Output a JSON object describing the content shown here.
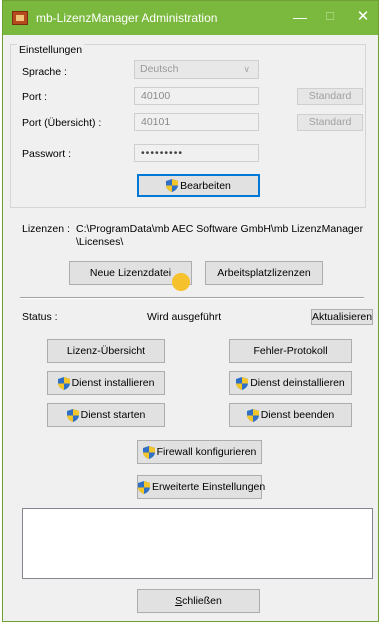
{
  "window": {
    "title": "mb-LizenzManager Administration",
    "controls": {
      "minimize": "—",
      "maximize": "☐",
      "close": "✕"
    },
    "accent_color": "#7ab93d"
  },
  "settings": {
    "group_label": "Einstellungen",
    "language": {
      "label": "Sprache :",
      "value": "Deutsch"
    },
    "port": {
      "label": "Port :",
      "value": "40100",
      "default_button": "Standard"
    },
    "port_overview": {
      "label": "Port (Übersicht) :",
      "value": "40101",
      "default_button": "Standard"
    },
    "password": {
      "label": "Passwort :",
      "value": "•••••••••"
    },
    "edit_button": "Bearbeiten"
  },
  "licenses": {
    "label": "Lizenzen :",
    "path_line1": "C:\\ProgramData\\mb AEC Software GmbH\\mb LizenzManager",
    "path_line2": "\\Licenses\\",
    "new_file_button": "Neue Lizenzdatei",
    "workstation_button": "Arbeitsplatzlizenzen"
  },
  "status": {
    "label": "Status :",
    "value": "Wird ausgeführt",
    "refresh_button": "Aktualisieren"
  },
  "actions": {
    "overview": "Lizenz-Übersicht",
    "error_log": "Fehler-Protokoll",
    "install_service": "Dienst installieren",
    "uninstall_service": "Dienst deinstallieren",
    "start_service": "Dienst starten",
    "stop_service": "Dienst beenden",
    "configure_firewall": "Firewall konfigurieren",
    "advanced_settings": "Erweiterte Einstellungen"
  },
  "footer": {
    "close_prefix": "",
    "close_mnemonic": "S",
    "close_rest": "chließen"
  }
}
